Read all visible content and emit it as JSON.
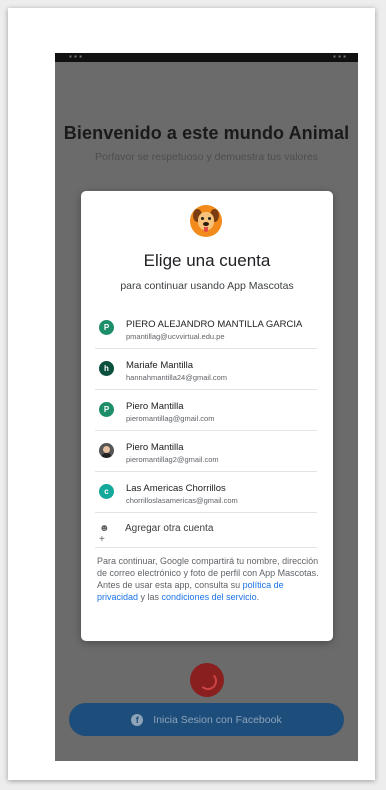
{
  "background_screen": {
    "title": "Bienvenido a este mundo Animal",
    "subtitle": "Porfavor se respetuoso y demuestra tus valores",
    "facebook_button": "Inicia Sesion con Facebook"
  },
  "dialog": {
    "title": "Elige una cuenta",
    "subtitle": "para continuar usando App Mascotas",
    "accounts": [
      {
        "initial": "P",
        "name": "PIERO ALEJANDRO MANTILLA GARCIA",
        "email": "pmantillag@ucvvirtual.edu.pe",
        "color": "#1e8e6a"
      },
      {
        "initial": "h",
        "name": "Mariafe Mantilla",
        "email": "hannahmantilla24@gmail.com",
        "color": "#0b4f3f"
      },
      {
        "initial": "P",
        "name": "Piero Mantilla",
        "email": "pieromantillag@gmail.com",
        "color": "#1e8e6a"
      },
      {
        "initial": "",
        "name": "Piero Mantilla",
        "email": "pieromantillag2@gmail.com",
        "color": "#555555"
      },
      {
        "initial": "c",
        "name": "Las Americas Chorrillos",
        "email": "chorrilloslasamericas@gmail.com",
        "color": "#14a89a"
      }
    ],
    "add_account": "Agregar otra cuenta",
    "disclaimer_text": "Para continuar, Google compartirá tu nombre, dirección de correo electrónico y foto de perfil con App Mascotas. Antes de usar esta app, consulta su ",
    "privacy_link": "política de privacidad",
    "and_text": " y las ",
    "terms_link": "condiciones del servicio",
    "end_text": "."
  }
}
